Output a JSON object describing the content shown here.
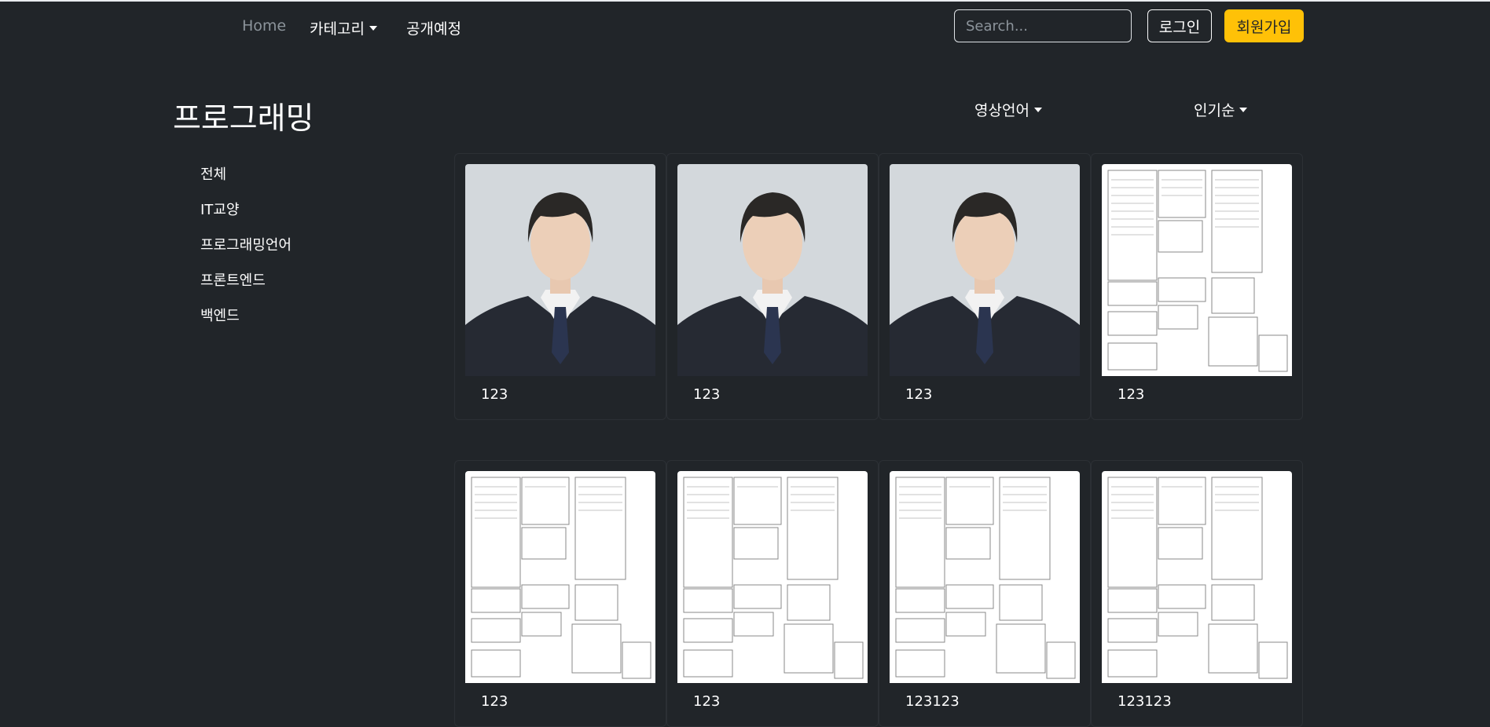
{
  "nav": {
    "home": "Home",
    "category": "카테고리",
    "upcoming": "공개예정",
    "search_placeholder": "Search...",
    "login": "로그인",
    "signup": "회원가입"
  },
  "page": {
    "title": "프로그래밍",
    "language_filter": "영상언어",
    "sort_filter": "인기순"
  },
  "sidebar": {
    "items": [
      {
        "label": "전체"
      },
      {
        "label": "IT교양"
      },
      {
        "label": "프로그래밍언어"
      },
      {
        "label": "프론트엔드"
      },
      {
        "label": "백엔드"
      }
    ]
  },
  "cards": [
    {
      "title": "123",
      "thumbnail": "portrait-photo"
    },
    {
      "title": "123",
      "thumbnail": "portrait-photo"
    },
    {
      "title": "123",
      "thumbnail": "portrait-photo"
    },
    {
      "title": "123",
      "thumbnail": "erd-diagram"
    },
    {
      "title": "123",
      "thumbnail": "erd-diagram"
    },
    {
      "title": "123",
      "thumbnail": "erd-diagram"
    },
    {
      "title": "123123",
      "thumbnail": "erd-diagram"
    },
    {
      "title": "123123",
      "thumbnail": "erd-diagram"
    }
  ],
  "colors": {
    "background": "#212529",
    "accent": "#ffc107",
    "muted_link": "#8c949b"
  }
}
